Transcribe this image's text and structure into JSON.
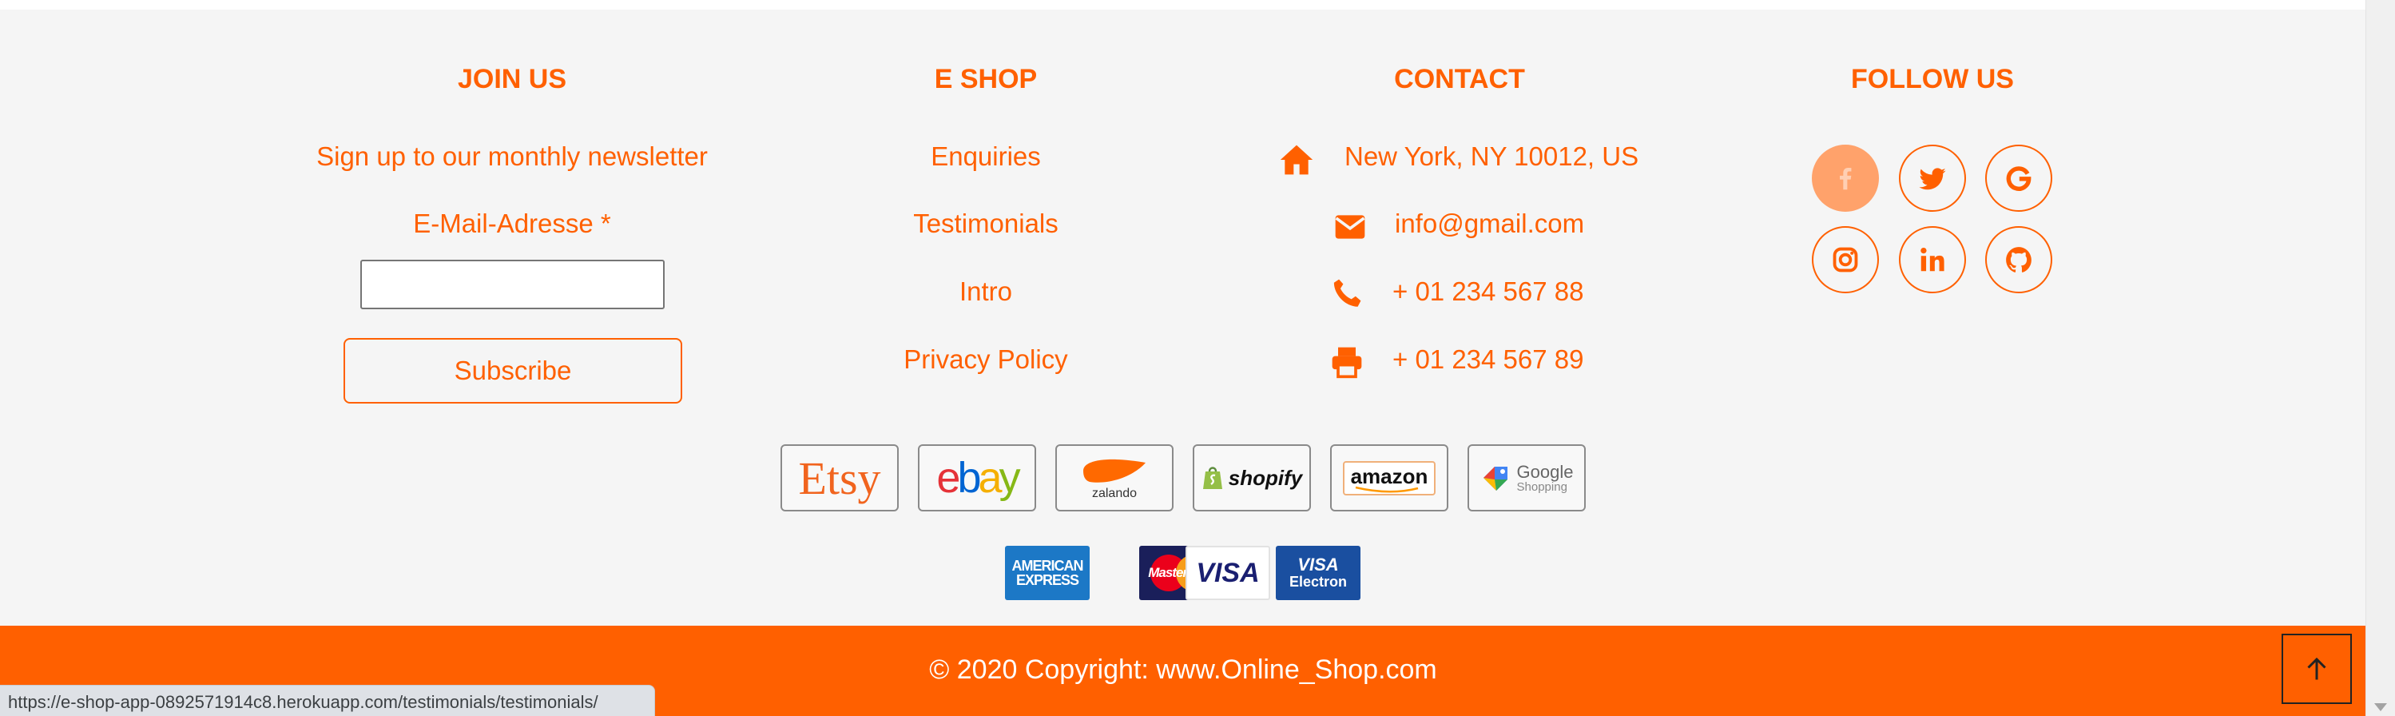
{
  "sections": {
    "join": {
      "heading": "JOIN US",
      "newsletter_text": "Sign up to our monthly newsletter",
      "email_label": "E-Mail-Adresse *",
      "email_value": "",
      "subscribe_label": "Subscribe"
    },
    "shop": {
      "heading": "E SHOP",
      "links": [
        "Enquiries",
        "Testimonials",
        "Intro",
        "Privacy Policy"
      ]
    },
    "contact": {
      "heading": "CONTACT",
      "address": "New York, NY 10012, US",
      "email": "info@gmail.com",
      "phone": "+ 01 234 567 88",
      "fax": "+ 01 234 567 89"
    },
    "follow": {
      "heading": "FOLLOW US",
      "icons": [
        "facebook-icon",
        "twitter-icon",
        "google-icon",
        "instagram-icon",
        "linkedin-icon",
        "github-icon"
      ]
    }
  },
  "marketplaces": {
    "etsy": "Etsy",
    "ebay": [
      "e",
      "b",
      "a",
      "y"
    ],
    "zalando": "zalando",
    "shopify": "shopify",
    "amazon": "amazon",
    "google_shopping": [
      "Google",
      "Shopping"
    ]
  },
  "payment_cards": {
    "amex": [
      "AMERICAN",
      "EXPRESS"
    ],
    "mastercard": "MasterCard",
    "visa": "VISA",
    "visa_electron": [
      "VISA",
      "Electron"
    ]
  },
  "footer": {
    "copyright": "© 2020 Copyright: www.Online_Shop.com"
  },
  "status_url": "https://e-shop-app-0892571914c8.herokuapp.com/testimonials/testimonials/",
  "colors": {
    "accent": "#ff6000",
    "active_social": "#ffa26b",
    "background": "#f5f5f5"
  }
}
